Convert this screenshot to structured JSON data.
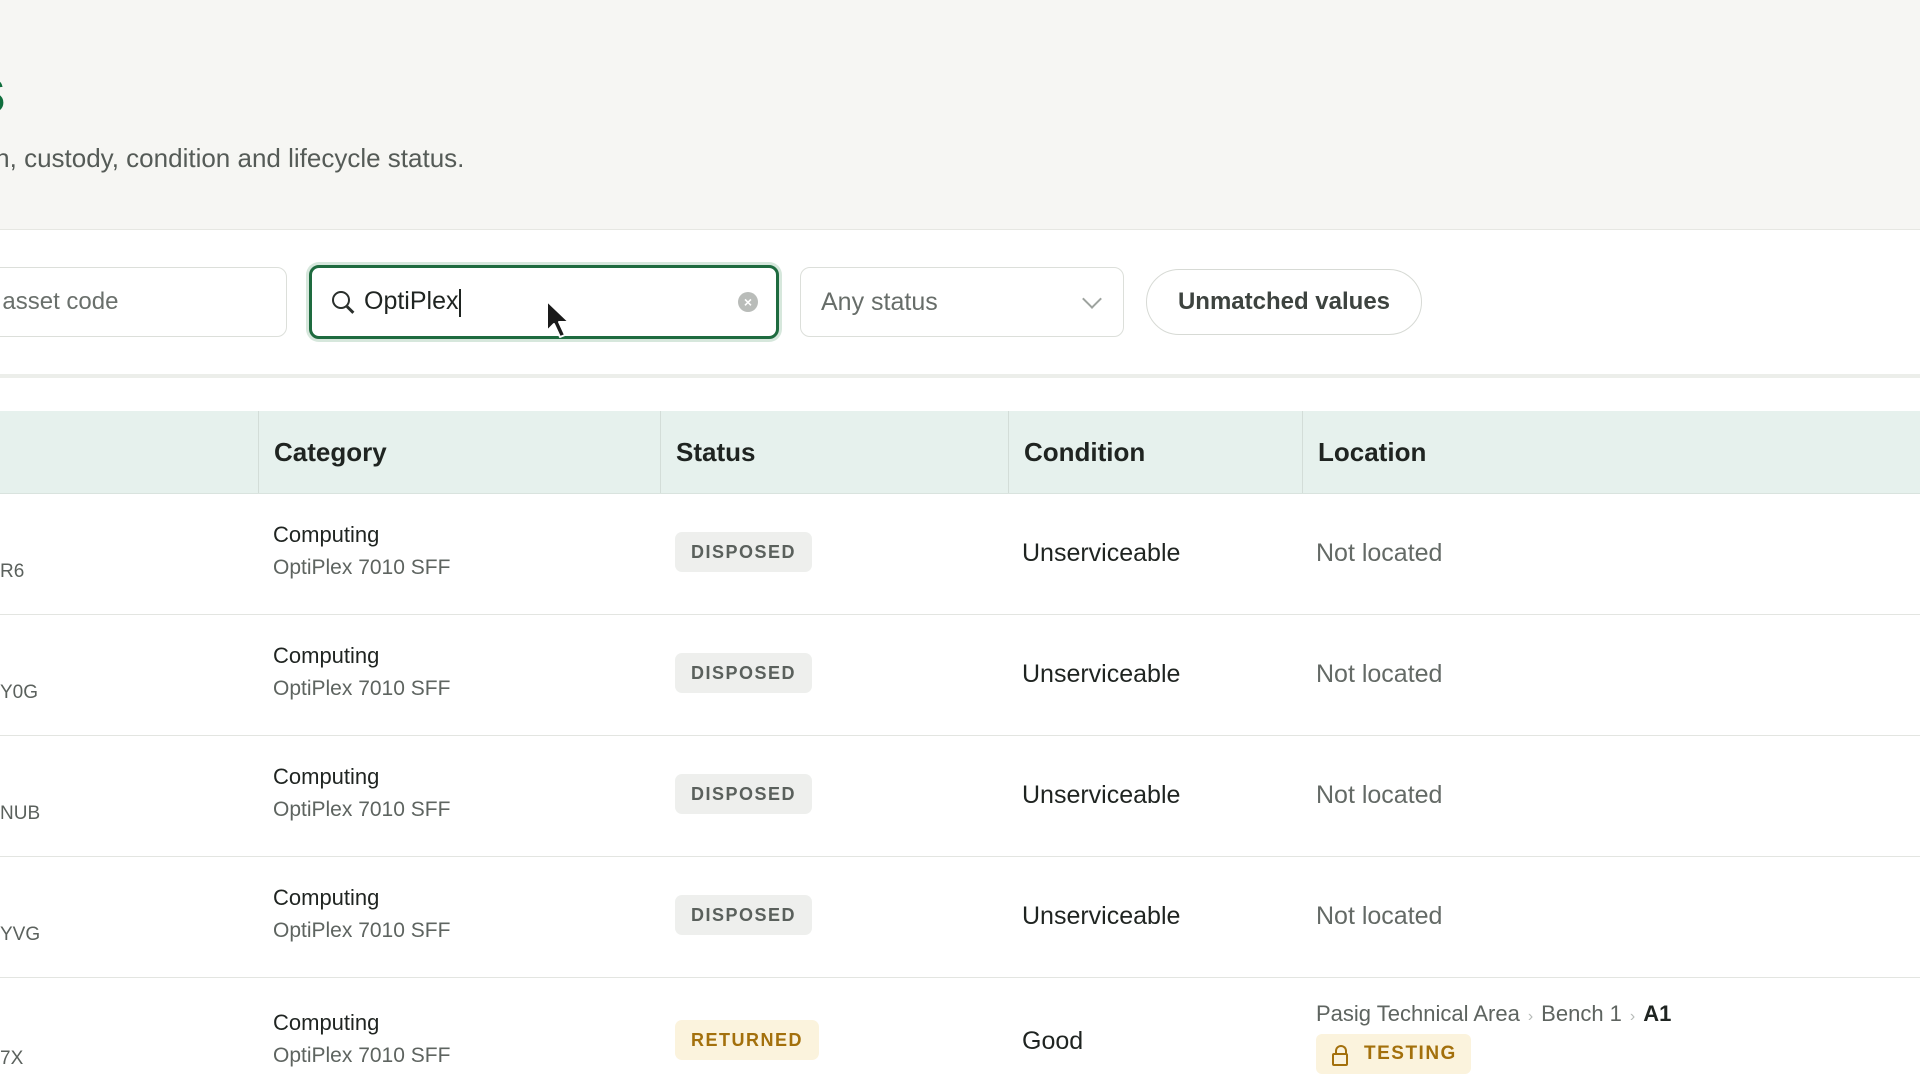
{
  "header": {
    "title": "ls",
    "subtitle": "location, custody, condition and lifecycle status."
  },
  "filters": {
    "barcode_placeholder": "de or asset code",
    "search_value": "OptiPlex",
    "status_value": "Any status",
    "unmatched_label": "Unmatched values"
  },
  "table": {
    "columns": [
      "Category",
      "Status",
      "Condition",
      "Location"
    ],
    "rows": [
      {
        "code": "R6",
        "category": "Computing",
        "model": "OptiPlex 7010 SFF",
        "status": "DISPOSED",
        "condition": "Unserviceable",
        "location": "Not located"
      },
      {
        "code": "Y0G",
        "category": "Computing",
        "model": "OptiPlex 7010 SFF",
        "status": "DISPOSED",
        "condition": "Unserviceable",
        "location": "Not located"
      },
      {
        "code": "NUB",
        "category": "Computing",
        "model": "OptiPlex 7010 SFF",
        "status": "DISPOSED",
        "condition": "Unserviceable",
        "location": "Not located"
      },
      {
        "code": "YVG",
        "category": "Computing",
        "model": "OptiPlex 7010 SFF",
        "status": "DISPOSED",
        "condition": "Unserviceable",
        "location": "Not located"
      },
      {
        "code": "7X",
        "category": "Computing",
        "model": "OptiPlex 7010 SFF",
        "status": "RETURNED",
        "condition": "Good",
        "location_path": [
          "Pasig Technical Area",
          "Bench 1",
          "A1"
        ],
        "location_tag": "TESTING"
      }
    ]
  },
  "colors": {
    "brand_green": "#0f6e3c",
    "header_row_bg": "#e6f1ed",
    "returned_badge": "#a3700c"
  }
}
